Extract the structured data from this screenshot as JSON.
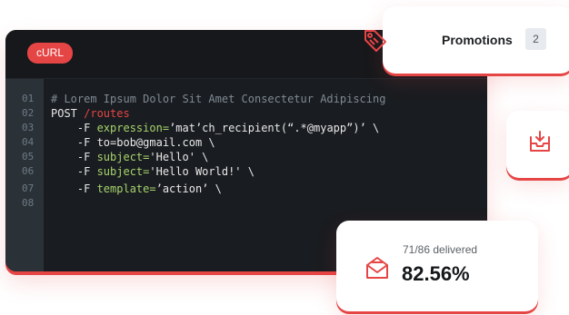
{
  "code_window": {
    "badge": "cURL",
    "line_numbers": [
      "01",
      "02",
      "03",
      "04",
      "05",
      "06",
      "07",
      "08"
    ],
    "lines": [
      [
        {
          "t": "# Lorem Ipsum Dolor Sit Amet Consectetur Adipiscing",
          "c": "c-comment"
        }
      ],
      [
        {
          "t": "POST ",
          "c": "c-key"
        },
        {
          "t": "/routes",
          "c": "c-red"
        }
      ],
      [
        {
          "t": "    -F ",
          "c": "c-key"
        },
        {
          "t": "expression=",
          "c": "c-green"
        },
        {
          "t": "’mat’ch_recipient(“.*@myapp”)’ \\",
          "c": "c-key"
        }
      ],
      [
        {
          "t": "    -F ",
          "c": "c-key"
        },
        {
          "t": "to=bob@gmail.com \\",
          "c": "c-key"
        }
      ],
      [
        {
          "t": "    -F ",
          "c": "c-key"
        },
        {
          "t": "subject=",
          "c": "c-green"
        },
        {
          "t": "'Hello' \\",
          "c": "c-key"
        }
      ],
      [
        {
          "t": "    -F ",
          "c": "c-key"
        },
        {
          "t": "subject=",
          "c": "c-green"
        },
        {
          "t": "'Hello World!' \\",
          "c": "c-key"
        }
      ],
      [
        {
          "t": "    -F ",
          "c": "c-key"
        },
        {
          "t": "template=",
          "c": "c-green"
        },
        {
          "t": "’action’ \\",
          "c": "c-key"
        }
      ],
      []
    ]
  },
  "promotions": {
    "label": "Promotions",
    "count": "2"
  },
  "stats": {
    "delivered": "71/86 delivered",
    "percent": "82.56%"
  },
  "icons": {
    "tag": "tag-icon",
    "inbox": "inbox-download-icon",
    "mail": "mail-icon"
  },
  "colors": {
    "accent": "#e64545",
    "editor_bg": "#191c20",
    "string_green": "#a8d36d"
  }
}
